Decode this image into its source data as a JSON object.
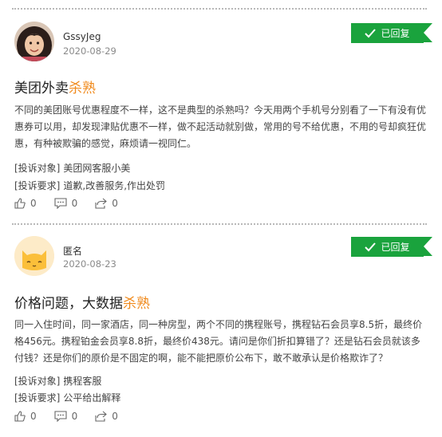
{
  "posts": [
    {
      "username": "GssyJeg",
      "date": "2020-08-29",
      "badge": "已回复",
      "title_main": "美团外卖",
      "title_hl": "杀熟",
      "body": "不同的美团账号优惠程度不一样，这不是典型的杀熟吗？今天用两个手机号分别看了一下有没有优惠券可以用，却发现津贴优惠不一样，做不起活动就别做，常用的号不给优惠，不用的号却疯狂优惠，有种被欺骗的感觉，麻烦请一视同仁。",
      "target_label": "[投诉对象]",
      "target_value": "美团网客服小美",
      "request_label": "[投诉要求]",
      "request_value": "道歉,改善服务,作出处罚",
      "likes": "0",
      "comments": "0",
      "shares": "0"
    },
    {
      "username": "匿名",
      "date": "2020-08-23",
      "badge": "已回复",
      "title_main": "价格问题，大数据",
      "title_hl": "杀熟",
      "body": "同一入住时间，同一家酒店，同一种房型，两个不同的携程账号，携程钻石会员享8.5折，最终价格456元。携程铂金会员享8.8折，最终价438元。请问是你们折扣算错了？还是钻石会员就该多付钱？还是你们的原价是不固定的啊，能不能把原价公布下，敢不敢承认是价格欺诈了？",
      "target_label": "[投诉对象]",
      "target_value": "携程客服",
      "request_label": "[投诉要求]",
      "request_value": "公平给出解释",
      "likes": "0",
      "comments": "0",
      "shares": "0"
    }
  ],
  "colors": {
    "badge": "#1aa33d",
    "highlight": "#f08a1c"
  },
  "icons": [
    "check-icon",
    "thumbs-up-icon",
    "comment-icon",
    "share-icon"
  ]
}
